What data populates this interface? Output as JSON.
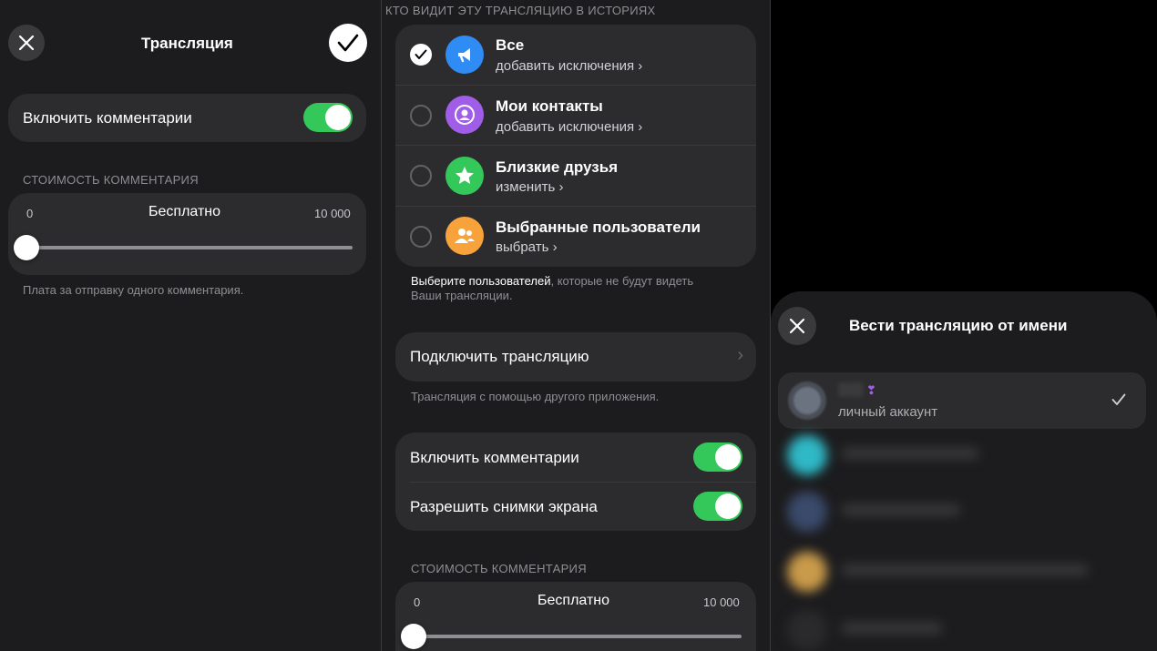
{
  "panel1": {
    "title": "Трансляция",
    "close_icon": "close-icon",
    "confirm_icon": "checkmark-icon",
    "toggle_label": "Включить комментарии",
    "toggle_on": true,
    "price_section_label": "СТОИМОСТЬ КОММЕНТАРИЯ",
    "slider_min": "0",
    "slider_value": "Бесплатно",
    "slider_max": "10 000",
    "slider_level": 0,
    "hint": "Плата за отправку одного комментария."
  },
  "panel2": {
    "section_label": "КТО ВИДИТ ЭТУ ТРАНСЛЯЦИЮ В ИСТОРИЯХ",
    "options": [
      {
        "title": "Все",
        "subtitle": "добавить исключения",
        "selected": true,
        "icon": "megaphone-icon",
        "color": "#2f8cf5"
      },
      {
        "title": "Мои контакты",
        "subtitle": "добавить исключения",
        "selected": false,
        "icon": "person-icon",
        "color": "#a05ee8"
      },
      {
        "title": "Близкие друзья",
        "subtitle": "изменить",
        "selected": false,
        "icon": "star-icon",
        "color": "#34c759"
      },
      {
        "title": "Выбранные пользователи",
        "subtitle": "выбрать",
        "selected": false,
        "icon": "group-icon",
        "color": "#f7a23b"
      }
    ],
    "hint_bold": "Выберите пользователей",
    "hint_rest": ", которые не будут видеть",
    "hint_line2": "Ваши трансляции.",
    "connect_label": "Подключить трансляцию",
    "connect_hint": "Трансляция с помощью другого приложения.",
    "toggle1_label": "Включить комментарии",
    "toggle2_label": "Разрешить снимки экрана",
    "price_section_label": "СТОИМОСТЬ КОММЕНТАРИЯ",
    "slider_min": "0",
    "slider_value": "Бесплатно",
    "slider_max": "10 000",
    "slider_level": 0
  },
  "panel3": {
    "title": "Вести трансляцию от имени",
    "close_icon": "close-icon",
    "account_subtitle": "личный аккаунт",
    "check_icon": "checkmark-icon"
  }
}
